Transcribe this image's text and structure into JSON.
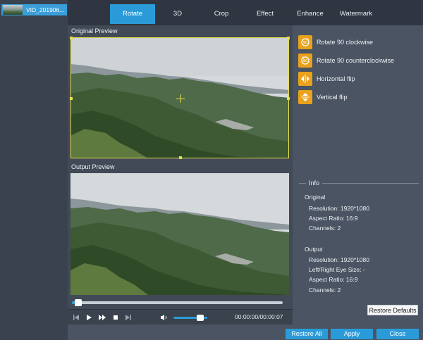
{
  "file_list": {
    "items": [
      {
        "name": "VID_201906..."
      }
    ]
  },
  "tabs": [
    {
      "label": "Rotate",
      "active": true
    },
    {
      "label": "3D",
      "active": false
    },
    {
      "label": "Crop",
      "active": false
    },
    {
      "label": "Effect",
      "active": false
    },
    {
      "label": "Enhance",
      "active": false
    },
    {
      "label": "Watermark",
      "active": false
    }
  ],
  "preview": {
    "original_label": "Original Preview",
    "output_label": "Output Preview",
    "progress": 0.03,
    "volume": 0.8,
    "timecode": "00:00:00/00:00:07"
  },
  "rotate_options": [
    {
      "label": "Rotate 90 clockwise",
      "icon": "rotate-cw-icon"
    },
    {
      "label": "Rotate 90 counterclockwise",
      "icon": "rotate-ccw-icon"
    },
    {
      "label": "Horizontal flip",
      "icon": "flip-horizontal-icon"
    },
    {
      "label": "Vertical flip",
      "icon": "flip-vertical-icon"
    }
  ],
  "info": {
    "title": "Info",
    "original_heading": "Original",
    "original_resolution": "Resolution: 1920*1080",
    "original_aspect": "Aspect Ratio: 16:9",
    "original_channels": "Channels: 2",
    "output_heading": "Output",
    "output_resolution": "Resolution: 1920*1080",
    "output_eye_size": "Left/Right Eye Size: -",
    "output_aspect": "Aspect Ratio: 16:9",
    "output_channels": "Channels: 2"
  },
  "buttons": {
    "restore_defaults": "Restore Defaults",
    "restore_all": "Restore All",
    "apply": "Apply",
    "close": "Close"
  },
  "colors": {
    "accent": "#2a9bd8",
    "option_icon": "#e8a21c",
    "crop_border": "#e8e04a"
  }
}
